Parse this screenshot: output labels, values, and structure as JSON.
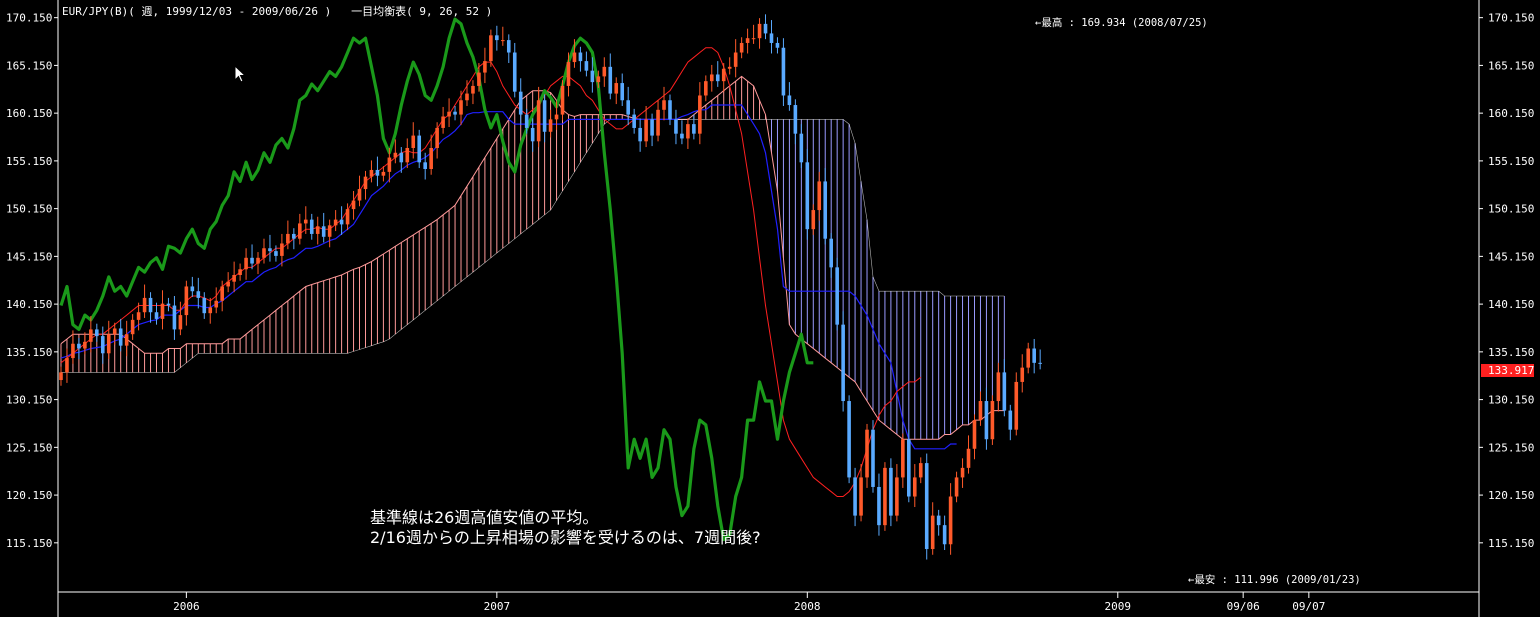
{
  "header": {
    "symbol": "EUR/JPY(B)(",
    "period": "週, 1999/12/03 - 2009/06/26 )",
    "indicator": "一目均衡表( 9, 26, 52 )"
  },
  "annotations": {
    "line1": "基準線は26週高値安値の平均。",
    "line2": "2/16週からの上昇相場の影響を受けるのは、7週間後?"
  },
  "marks": {
    "high_label": "←最高 : 169.934 (2008/07/25)",
    "low_label": "←最安 : 111.996 (2009/01/23)",
    "current_price": "133.917"
  },
  "colors": {
    "background": "#000000",
    "tenkan": "#ff2020",
    "kijun": "#2020ff",
    "chikou": "#1a9a1a",
    "kumo_bull": "#ff9a9a",
    "kumo_bear": "#9a9aff",
    "candle_up": "#ff5a2a",
    "candle_down": "#5aaaff",
    "price_tag": "#ff2020"
  },
  "chart_data": {
    "type": "candlestick",
    "title": "EUR/JPY(B)( 週, 1999/12/03 - 2009/06/26 ) 一目均衡表( 9, 26, 52 )",
    "ylim": [
      110.0,
      172.0
    ],
    "y_ticks": [
      "170.150",
      "165.150",
      "160.150",
      "155.150",
      "150.150",
      "145.150",
      "140.150",
      "135.150",
      "130.150",
      "125.150",
      "120.150",
      "115.150"
    ],
    "x_ticks": [
      "2006",
      "2007",
      "2008",
      "2009",
      "09/06",
      "09/07"
    ],
    "x_tick_weeks": [
      21,
      73,
      125,
      177,
      198,
      209
    ],
    "total_weeks": 238,
    "series": [
      {
        "name": "close",
        "values": [
          133.0,
          134.5,
          136.0,
          135.5,
          136.2,
          137.5,
          136.8,
          135.0,
          137.0,
          137.6,
          135.8,
          137.0,
          138.5,
          139.3,
          140.8,
          139.3,
          138.6,
          140.2,
          140.0,
          137.5,
          139.0,
          142.0,
          141.5,
          140.8,
          139.2,
          139.8,
          140.5,
          142.0,
          142.5,
          143.2,
          143.8,
          145.0,
          144.4,
          145.0,
          146.0,
          145.7,
          145.2,
          146.5,
          147.5,
          147.0,
          148.6,
          149.0,
          147.5,
          148.3,
          147.2,
          148.4,
          149.0,
          148.5,
          150.1,
          151.0,
          152.2,
          153.5,
          154.2,
          153.6,
          154.0,
          155.5,
          156.0,
          155.0,
          156.5,
          157.8,
          155.0,
          154.3,
          156.5,
          158.6,
          159.8,
          160.3,
          160.0,
          161.5,
          162.2,
          163.0,
          164.4,
          165.6,
          168.3,
          167.8,
          167.8,
          166.5,
          162.4,
          160.0,
          158.6,
          157.2,
          161.5,
          158.2,
          159.5,
          160.0,
          163.0,
          165.5,
          166.5,
          165.6,
          164.6,
          163.4,
          164.0,
          165.0,
          162.2,
          163.3,
          161.5,
          160.0,
          158.6,
          157.2,
          159.5,
          157.8,
          160.5,
          161.5,
          159.5,
          158.0,
          157.5,
          159.0,
          158.0,
          162.0,
          163.5,
          164.2,
          163.5,
          164.8,
          165.0,
          166.5,
          167.5,
          168.0,
          168.0,
          169.5,
          168.5,
          167.5,
          167.0,
          162.0,
          161.0,
          158.0,
          155.0,
          148.0,
          150.0,
          153.0,
          147.0,
          144.0,
          138.0,
          130.0,
          122.0,
          118.0,
          122.0,
          127.0,
          121.0,
          117.0,
          123.0,
          118.0,
          122.0,
          126.0,
          120.0,
          122.0,
          123.5,
          114.5,
          118.0,
          117.0,
          115.0,
          120.0,
          122.0,
          123.0,
          125.0,
          128.0,
          130.0,
          126.0,
          130.0,
          133.0,
          129.0,
          127.0,
          132.0,
          133.5,
          135.5,
          134.0,
          133.917
        ]
      },
      {
        "name": "chikou",
        "values": [
          140.0,
          142.0,
          138.0,
          137.5,
          139.0,
          138.5,
          139.5,
          141.0,
          143.0,
          141.5,
          142.0,
          141.0,
          142.5,
          144.0,
          143.5,
          144.5,
          145.0,
          143.8,
          146.2,
          146.0,
          145.5,
          147.0,
          148.0,
          146.5,
          146.0,
          148.0,
          148.8,
          150.5,
          151.5,
          154.0,
          153.0,
          155.0,
          153.2,
          154.2,
          156.0,
          155.0,
          156.8,
          157.5,
          156.5,
          158.5,
          161.5,
          162.0,
          163.2,
          162.5,
          163.5,
          164.5,
          164.0,
          165.0,
          166.5,
          168.0,
          167.5,
          168.0,
          165.0,
          162.0,
          157.5,
          156.0,
          158.0,
          161.0,
          163.5,
          165.5,
          164.2,
          162.0,
          161.5,
          163.0,
          165.0,
          168.0,
          170.0,
          169.5,
          167.5,
          166.0,
          163.8,
          160.5,
          158.6,
          160.0,
          157.2,
          155.0,
          154.0,
          156.8,
          158.5,
          160.0,
          161.0,
          162.5,
          161.8,
          160.8,
          163.0,
          165.5,
          167.2,
          168.0,
          167.5,
          166.5,
          163.0,
          156.0,
          150.0,
          143.0,
          135.0,
          123.0,
          126.0,
          124.0,
          126.0,
          122.0,
          123.0,
          127.0,
          126.0,
          121.0,
          118.0,
          119.0,
          125.0,
          128.0,
          127.5,
          124.0,
          119.0,
          115.5,
          116.0,
          120.0,
          122.0,
          128.0,
          128.0,
          132.0,
          130.0,
          130.0,
          126.0,
          130.0,
          133.0,
          135.0,
          137.0,
          134.0,
          134.0
        ]
      },
      {
        "name": "kijun",
        "values": [
          134.5,
          134.7,
          135.0,
          135.1,
          135.3,
          135.5,
          135.6,
          135.7,
          136.0,
          136.3,
          136.5,
          137.0,
          137.5,
          138.0,
          138.2,
          138.4,
          138.5,
          139.0,
          139.0,
          139.0,
          139.5,
          140.0,
          140.0,
          140.0,
          139.8,
          139.8,
          140.2,
          140.5,
          141.0,
          141.5,
          142.0,
          142.5,
          142.5,
          143.0,
          143.5,
          143.8,
          144.0,
          144.5,
          144.8,
          145.0,
          145.5,
          146.0,
          146.0,
          146.2,
          146.5,
          146.8,
          147.0,
          147.5,
          148.0,
          148.5,
          149.5,
          150.5,
          151.5,
          152.0,
          152.5,
          153.2,
          153.8,
          154.2,
          154.7,
          155.0,
          155.2,
          155.5,
          156.0,
          156.7,
          157.4,
          157.8,
          158.3,
          159.0,
          160.0,
          160.2,
          160.2,
          160.3,
          160.3,
          160.3,
          160.3,
          159.5,
          159.0,
          159.0,
          159.0,
          159.0,
          159.0,
          159.0,
          159.0,
          159.0,
          159.0,
          159.5,
          159.5,
          159.5,
          159.5,
          159.5,
          159.5,
          159.5,
          159.5,
          159.5,
          159.5,
          159.5,
          159.5,
          159.5,
          159.5,
          159.5,
          159.5,
          159.5,
          159.5,
          159.5,
          159.8,
          160.0,
          160.3,
          160.5,
          160.5,
          161.0,
          161.0,
          161.0,
          161.0,
          161.0,
          161.0,
          160.0,
          159.0,
          158.0,
          156.0,
          152.0,
          148.0,
          142.0,
          141.5,
          141.5,
          141.5,
          141.5,
          141.5,
          141.5,
          141.5,
          141.5,
          141.5,
          141.5,
          141.5,
          141.0,
          140.0,
          139.0,
          137.5,
          136.0,
          135.0,
          134.0,
          131.0,
          128.0,
          126.0,
          125.0,
          125.0,
          125.0,
          125.0,
          125.0,
          125.0,
          125.5,
          125.5
        ]
      },
      {
        "name": "tenkan",
        "values": [
          134.0,
          134.5,
          135.0,
          135.5,
          136.0,
          136.5,
          137.0,
          137.0,
          137.5,
          138.0,
          138.5,
          139.0,
          139.5,
          140.0,
          140.0,
          140.0,
          140.0,
          140.0,
          140.0,
          139.5,
          139.5,
          140.5,
          141.0,
          141.0,
          140.8,
          140.5,
          141.0,
          142.0,
          142.5,
          143.0,
          143.5,
          144.0,
          144.0,
          144.5,
          145.0,
          145.5,
          146.0,
          146.0,
          146.5,
          147.0,
          147.5,
          148.0,
          148.0,
          148.2,
          148.0,
          148.0,
          148.5,
          149.0,
          150.0,
          151.0,
          152.0,
          153.0,
          153.5,
          154.0,
          154.5,
          155.0,
          155.5,
          156.0,
          156.2,
          156.0,
          156.0,
          156.5,
          157.5,
          158.5,
          159.5,
          160.0,
          161.0,
          162.0,
          163.0,
          164.0,
          165.0,
          165.5,
          165.5,
          164.5,
          163.0,
          162.0,
          161.0,
          160.5,
          160.0,
          160.5,
          161.0,
          162.0,
          163.0,
          163.5,
          164.0,
          164.0,
          163.5,
          163.0,
          162.0,
          161.5,
          160.5,
          159.5,
          159.0,
          158.5,
          158.5,
          159.0,
          159.5,
          160.0,
          160.5,
          161.0,
          161.5,
          162.0,
          162.5,
          163.5,
          164.5,
          165.5,
          166.0,
          166.5,
          167.0,
          167.0,
          166.5,
          165.0,
          163.0,
          160.5,
          158.0,
          154.0,
          150.0,
          145.0,
          140.0,
          136.0,
          132.0,
          128.0,
          126.0,
          125.0,
          124.0,
          123.0,
          122.0,
          121.5,
          121.0,
          120.5,
          120.0,
          120.0,
          120.5,
          121.5,
          123.0,
          125.0,
          127.0,
          128.5,
          129.5,
          130.0,
          131.0,
          131.5,
          132.0,
          132.0,
          132.5
        ]
      },
      {
        "name": "senkou_a",
        "values": [
          136.0,
          136.5,
          137.0,
          137.0,
          137.0,
          137.0,
          137.0,
          137.0,
          137.0,
          137.0,
          137.0,
          136.5,
          136.0,
          135.5,
          135.0,
          135.0,
          135.0,
          135.0,
          135.5,
          135.5,
          135.5,
          136.0,
          136.0,
          136.0,
          136.0,
          136.0,
          136.0,
          136.0,
          136.5,
          136.5,
          136.5,
          137.0,
          137.5,
          138.0,
          138.5,
          139.0,
          139.5,
          140.0,
          140.5,
          141.0,
          141.5,
          142.0,
          142.2,
          142.4,
          142.6,
          142.8,
          143.0,
          143.2,
          143.5,
          143.8,
          144.0,
          144.3,
          144.6,
          145.0,
          145.4,
          145.8,
          146.2,
          146.6,
          147.0,
          147.4,
          147.8,
          148.2,
          148.6,
          149.0,
          149.5,
          150.0,
          150.5,
          151.5,
          152.5,
          153.5,
          154.5,
          155.5,
          156.5,
          157.5,
          158.5,
          159.5,
          160.5,
          161.5,
          162.0,
          162.5,
          162.5,
          162.5,
          162.3,
          161.5,
          160.5,
          160.0,
          159.8,
          160.0,
          160.0,
          160.0,
          160.0,
          160.0,
          160.0,
          160.0,
          160.0,
          159.8,
          159.6,
          159.5,
          159.5,
          159.5,
          159.5,
          159.5,
          159.5,
          159.5,
          159.5,
          159.5,
          160.0,
          160.5,
          161.0,
          161.5,
          162.0,
          162.5,
          163.0,
          163.5,
          164.0,
          163.5,
          163.0,
          161.5,
          160.0,
          156.0,
          152.0,
          145.0,
          138.0,
          137.0,
          136.5,
          136.0,
          135.5,
          135.0,
          134.5,
          134.0,
          133.5,
          133.0,
          132.5,
          132.0,
          131.0,
          130.0,
          129.0,
          128.0,
          127.5,
          127.0,
          126.5,
          126.0,
          126.0,
          126.0,
          126.0,
          126.0,
          126.0,
          126.0,
          126.5,
          126.5,
          127.0,
          127.5,
          127.5,
          128.0,
          128.0,
          128.5,
          129.0,
          129.0,
          129.0
        ]
      },
      {
        "name": "senkou_b",
        "values": [
          133.0,
          133.0,
          133.0,
          133.0,
          133.0,
          133.0,
          133.0,
          133.0,
          133.0,
          133.0,
          133.0,
          133.0,
          133.0,
          133.0,
          133.0,
          133.0,
          133.0,
          133.0,
          133.0,
          133.0,
          133.5,
          134.0,
          134.5,
          135.0,
          135.0,
          135.0,
          135.0,
          135.0,
          135.0,
          135.0,
          135.0,
          135.0,
          135.0,
          135.0,
          135.0,
          135.0,
          135.0,
          135.0,
          135.0,
          135.0,
          135.0,
          135.0,
          135.0,
          135.0,
          135.0,
          135.0,
          135.0,
          135.0,
          135.0,
          135.2,
          135.4,
          135.6,
          135.8,
          136.0,
          136.2,
          136.5,
          137.0,
          137.5,
          138.0,
          138.5,
          139.0,
          139.5,
          140.0,
          140.5,
          141.0,
          141.5,
          142.0,
          142.5,
          143.0,
          143.5,
          144.0,
          144.5,
          145.0,
          145.5,
          146.0,
          146.5,
          147.0,
          147.5,
          148.0,
          148.5,
          149.0,
          149.5,
          150.0,
          151.0,
          152.0,
          153.0,
          154.0,
          155.0,
          156.0,
          157.0,
          158.0,
          159.0,
          159.5,
          159.5,
          159.5,
          159.5,
          159.5,
          159.5,
          159.5,
          159.5,
          159.5,
          159.5,
          159.5,
          159.5,
          159.5,
          159.5,
          159.5,
          159.5,
          159.5,
          159.5,
          159.5,
          159.5,
          159.5,
          159.5,
          159.5,
          159.5,
          159.5,
          159.5,
          159.5,
          159.5,
          159.5,
          159.5,
          159.5,
          159.5,
          159.5,
          159.5,
          159.5,
          159.5,
          159.5,
          159.5,
          159.5,
          159.5,
          159.0,
          157.0,
          153.0,
          149.0,
          143.0,
          141.5,
          141.5,
          141.5,
          141.5,
          141.5,
          141.5,
          141.5,
          141.5,
          141.5,
          141.5,
          141.5,
          141.0,
          141.0,
          141.0,
          141.0,
          141.0,
          141.0,
          141.0,
          141.0,
          141.0,
          141.0,
          141.0
        ]
      }
    ]
  }
}
